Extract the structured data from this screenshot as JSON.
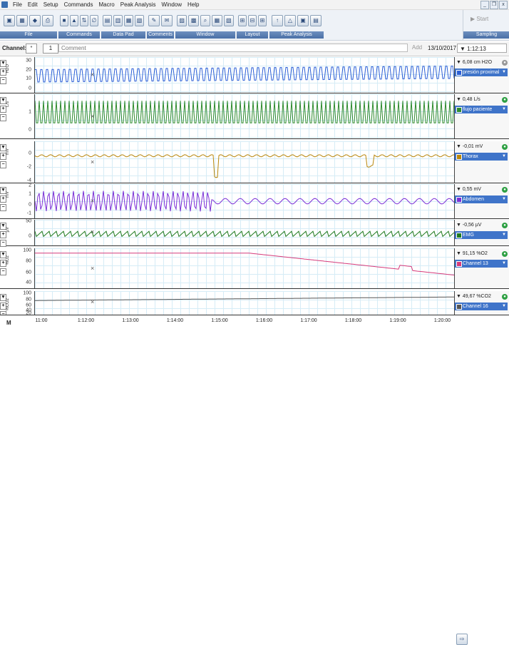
{
  "menubar": {
    "items": [
      "File",
      "Edit",
      "Setup",
      "Commands",
      "Macro",
      "Peak Analysis",
      "Window",
      "Help"
    ],
    "window_buttons": [
      "_",
      "❐",
      "x"
    ]
  },
  "ribbon": {
    "groups": [
      {
        "label": "File",
        "icons": [
          "▣",
          "▦",
          "◆",
          "⎙"
        ]
      },
      {
        "label": "Commands",
        "icons": [
          "■",
          "▲",
          "⇅",
          "∅"
        ]
      },
      {
        "label": "Data Pad",
        "icons": [
          "▤",
          "▥",
          "▦",
          "▧"
        ]
      },
      {
        "label": "Comments",
        "icons": [
          "✎",
          "✉"
        ]
      },
      {
        "label": "Window",
        "icons": [
          "▨",
          "▩",
          "⌕",
          "▦",
          "▧"
        ]
      },
      {
        "label": "Layout",
        "icons": [
          "⊞",
          "⊟",
          "⊞"
        ]
      },
      {
        "label": "Peak Analysis",
        "icons": [
          "↑",
          "△",
          "▣",
          "▤"
        ]
      }
    ],
    "sampling": {
      "label": "Sampling",
      "start_label": "Start"
    }
  },
  "channel_bar": {
    "label": "Channel:",
    "selector": "*",
    "number": "1",
    "comment_placeholder": "Comment",
    "add_label": "Add",
    "date": "13/10/2017",
    "time": "1:12:13"
  },
  "channels": [
    {
      "unit": "H2O",
      "ticks": [
        "30",
        "20",
        "10",
        "0"
      ],
      "value": "6,08 cm H2O",
      "name": "presión proximal",
      "color": "#2c5fd6",
      "status": "gray"
    },
    {
      "unit": "L/s",
      "ticks": [
        "1",
        "0"
      ],
      "value": "0,48 L/s",
      "name": "flujo paciente",
      "color": "#2e8b2e",
      "status": "green"
    },
    {
      "unit": "mV",
      "ticks": [
        "0",
        "-2",
        "-4"
      ],
      "value": "-0,01 mV",
      "name": "Thorax",
      "color": "#b8860b",
      "status": "green"
    },
    {
      "unit": "mV",
      "ticks": [
        "2",
        "1",
        "0",
        "-1"
      ],
      "value": "0,55 mV",
      "name": "Abdomen",
      "color": "#7b2fd6",
      "status": "green"
    },
    {
      "unit": "µV",
      "ticks": [
        "50",
        "0"
      ],
      "value": "-0,56 µV",
      "name": "EMG",
      "color": "#1f7a1f",
      "status": "green"
    },
    {
      "unit": "%O2",
      "ticks": [
        "100",
        "80",
        "60",
        "40"
      ],
      "value": "91,15 %O2",
      "name": "Channel 13",
      "color": "#d63a7a",
      "status": "green"
    },
    {
      "unit": "%CO2",
      "ticks": [
        "100",
        "80",
        "60",
        "40",
        "20"
      ],
      "value": "49,67 %CO2",
      "name": "Channel 16",
      "color": "#555555",
      "status": "green"
    }
  ],
  "time_axis": {
    "m_label": "M",
    "labels": [
      "11:00",
      "1:12:00",
      "1:13:00",
      "1:14:00",
      "1:15:00",
      "1:16:00",
      "1:17:00",
      "1:18:00",
      "1:19:00",
      "1:20:00"
    ]
  }
}
